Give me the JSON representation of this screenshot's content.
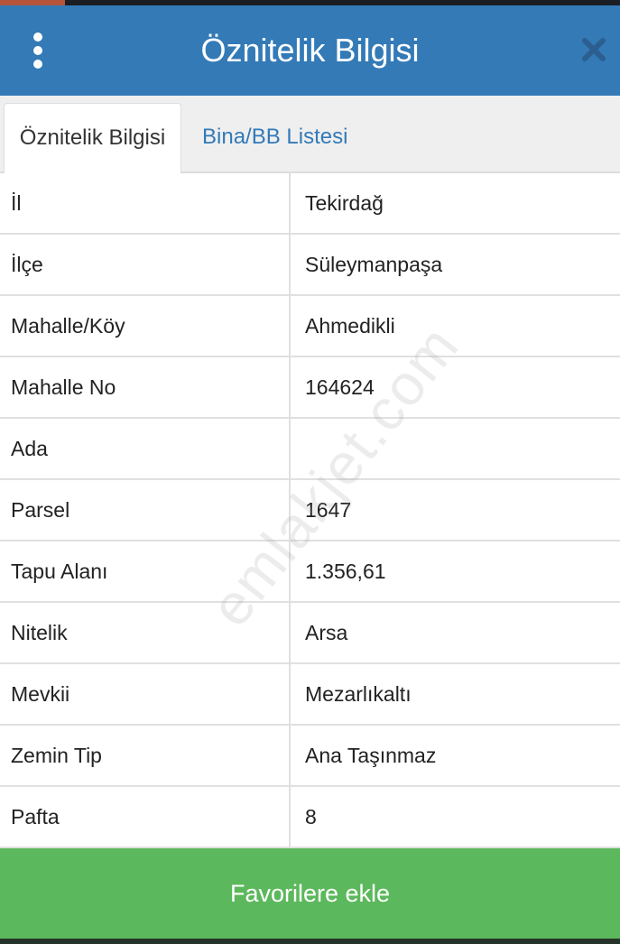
{
  "header": {
    "title": "Öznitelik Bilgisi",
    "menu_icon": "more-vertical-icon",
    "close_icon": "close-icon"
  },
  "tabs": [
    {
      "label": "Öznitelik Bilgisi",
      "active": true
    },
    {
      "label": "Bina/BB Listesi",
      "active": false
    }
  ],
  "rows": [
    {
      "label": "İl",
      "value": "Tekirdağ"
    },
    {
      "label": "İlçe",
      "value": "Süleymanpaşa"
    },
    {
      "label": "Mahalle/Köy",
      "value": "Ahmedikli"
    },
    {
      "label": "Mahalle No",
      "value": "164624"
    },
    {
      "label": "Ada",
      "value": ""
    },
    {
      "label": "Parsel",
      "value": "1647"
    },
    {
      "label": "Tapu Alanı",
      "value": "1.356,61"
    },
    {
      "label": "Nitelik",
      "value": "Arsa"
    },
    {
      "label": "Mevkii",
      "value": "Mezarlıkaltı"
    },
    {
      "label": "Zemin Tip",
      "value": "Ana Taşınmaz"
    },
    {
      "label": "Pafta",
      "value": "8"
    }
  ],
  "watermark": "emlakjet.com",
  "footer": {
    "favorite_label": "Favorilere ekle"
  },
  "colors": {
    "header": "#337ab7",
    "button": "#5cb85c",
    "tab_link": "#337ab7"
  }
}
